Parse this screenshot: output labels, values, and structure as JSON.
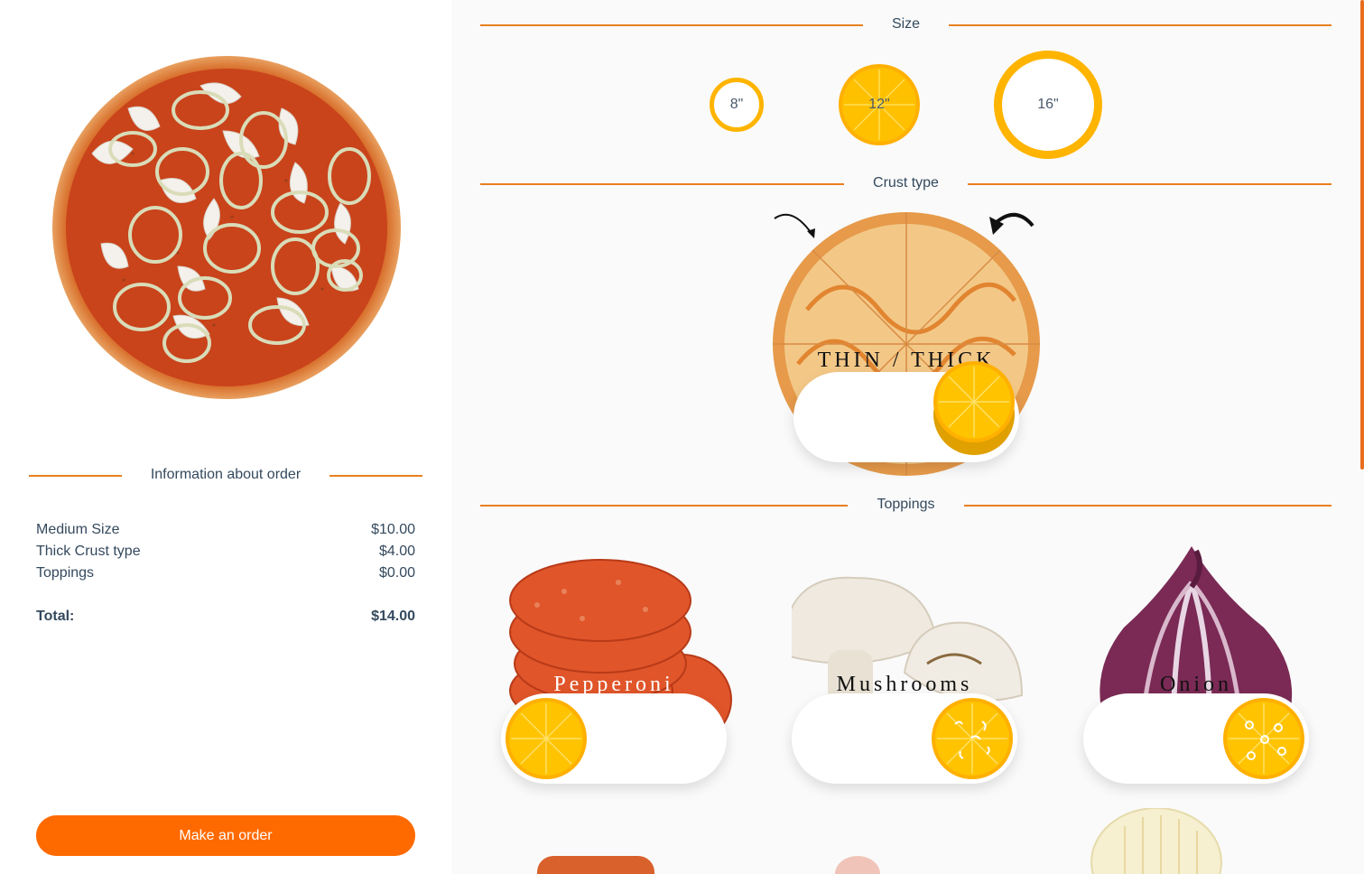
{
  "order_info": {
    "title": "Information about order",
    "rows": [
      {
        "label": "Medium Size",
        "price": "$10.00"
      },
      {
        "label": "Thick Crust type",
        "price": "$4.00"
      },
      {
        "label": "Toppings",
        "price": "$0.00"
      }
    ],
    "total_label": "Total:",
    "total_value": "$14.00",
    "button_label": "Make an order"
  },
  "size_section": {
    "title": "Size",
    "options": [
      "8\"",
      "12\"",
      "16\""
    ],
    "selected": "12\""
  },
  "crust_section": {
    "title": "Crust type",
    "label": "THIN / THICK",
    "selected": "THICK"
  },
  "toppings_section": {
    "title": "Toppings",
    "items": [
      {
        "name": "Pepperoni",
        "enabled": false
      },
      {
        "name": "Mushrooms",
        "enabled": true
      },
      {
        "name": "Onion",
        "enabled": true
      }
    ]
  },
  "colors": {
    "accent": "#ff6a00",
    "divider": "#e8801f",
    "knob": "#ffc300",
    "text": "#34495e"
  },
  "icons": [
    "pizza-preview-image",
    "crust-pizza-image",
    "rotate-arrow-icon",
    "pepperoni-image",
    "mushrooms-image",
    "onion-image"
  ]
}
